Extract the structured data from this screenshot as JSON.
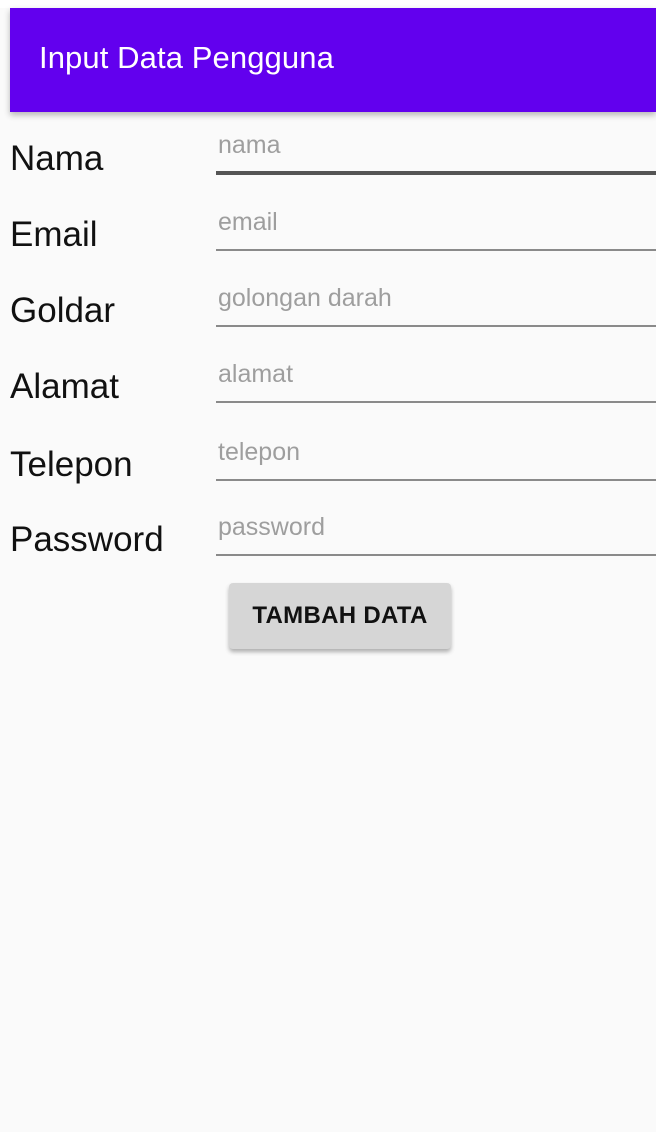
{
  "app_bar": {
    "title": "Input Data Pengguna",
    "color": "#6200ee"
  },
  "form": {
    "fields": [
      {
        "label": "Nama",
        "placeholder": "nama",
        "value": ""
      },
      {
        "label": "Email",
        "placeholder": "email",
        "value": ""
      },
      {
        "label": "Goldar",
        "placeholder": "golongan darah",
        "value": ""
      },
      {
        "label": "Alamat",
        "placeholder": "alamat",
        "value": ""
      },
      {
        "label": "Telepon",
        "placeholder": "telepon",
        "value": ""
      },
      {
        "label": "Password",
        "placeholder": "password",
        "value": ""
      }
    ],
    "submit_label": "TAMBAH DATA"
  }
}
